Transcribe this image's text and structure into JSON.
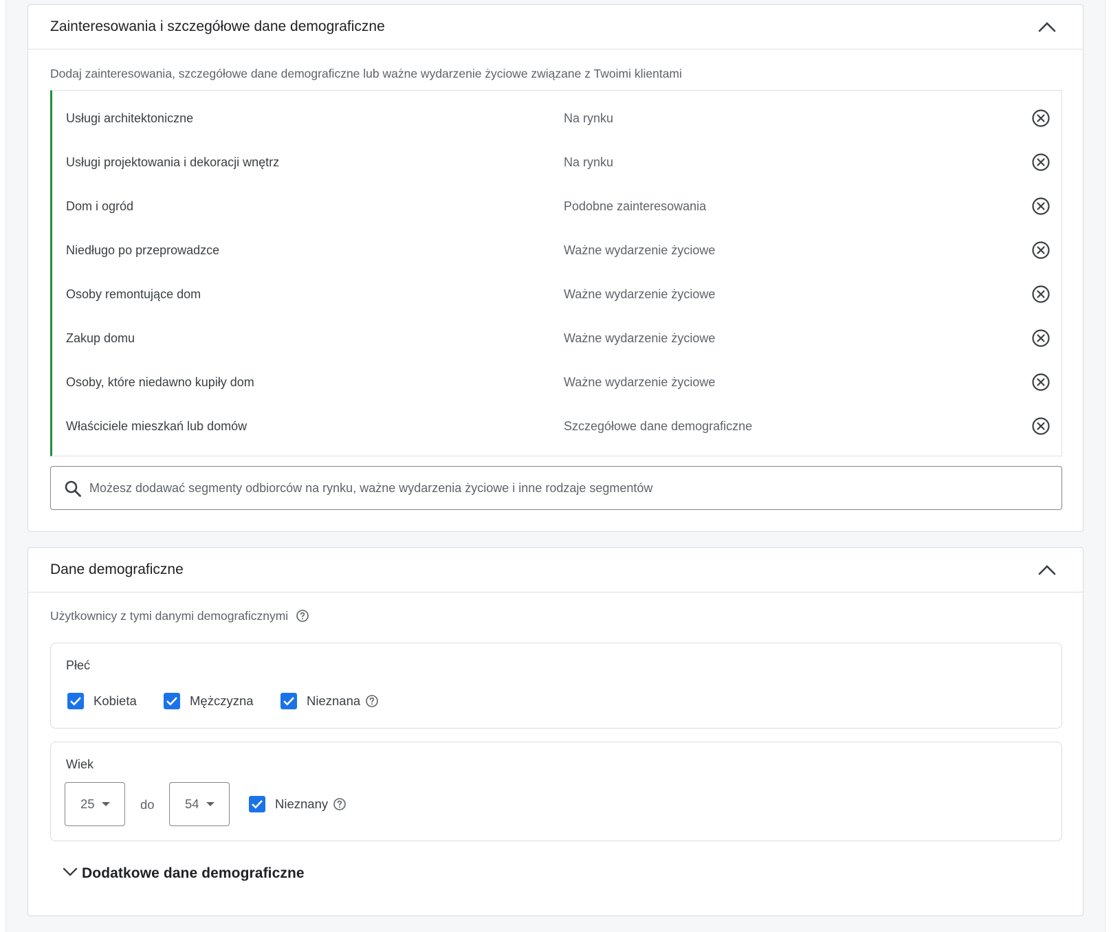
{
  "interests": {
    "title": "Zainteresowania i szczegółowe dane demograficzne",
    "description": "Dodaj zainteresowania, szczegółowe dane demograficzne lub ważne wydarzenie życiowe związane z Twoimi klientami",
    "segments": [
      {
        "name": "Usługi architektoniczne",
        "type": "Na rynku"
      },
      {
        "name": "Usługi projektowania i dekoracji wnętrz",
        "type": "Na rynku"
      },
      {
        "name": "Dom i ogród",
        "type": "Podobne zainteresowania"
      },
      {
        "name": "Niedługo po przeprowadzce",
        "type": "Ważne wydarzenie życiowe"
      },
      {
        "name": "Osoby remontujące dom",
        "type": "Ważne wydarzenie życiowe"
      },
      {
        "name": "Zakup domu",
        "type": "Ważne wydarzenie życiowe"
      },
      {
        "name": "Osoby, które niedawno kupiły dom",
        "type": "Ważne wydarzenie życiowe"
      },
      {
        "name": "Właściciele mieszkań lub domów",
        "type": "Szczegółowe dane demograficzne"
      }
    ],
    "search_placeholder": "Możesz dodawać segmenty odbiorców na rynku, ważne wydarzenia życiowe i inne rodzaje segmentów"
  },
  "demographics": {
    "title": "Dane demograficzne",
    "description": "Użytkownicy z tymi danymi demograficznymi",
    "gender": {
      "label": "Płeć",
      "options": [
        {
          "label": "Kobieta",
          "checked": true
        },
        {
          "label": "Mężczyzna",
          "checked": true
        },
        {
          "label": "Nieznana",
          "checked": true
        }
      ]
    },
    "age": {
      "label": "Wiek",
      "from": "25",
      "to_label": "do",
      "to": "54",
      "unknown_label": "Nieznany",
      "unknown_checked": true
    },
    "additional_label": "Dodatkowe dane demograficzne"
  },
  "colors": {
    "accent": "#1a73e8",
    "segment_bar": "#1e8e3e"
  },
  "icons": {
    "collapse": "chevron-up-icon",
    "remove": "close-circle-icon",
    "search": "search-icon",
    "help": "help-icon",
    "expand": "chevron-down-icon"
  }
}
